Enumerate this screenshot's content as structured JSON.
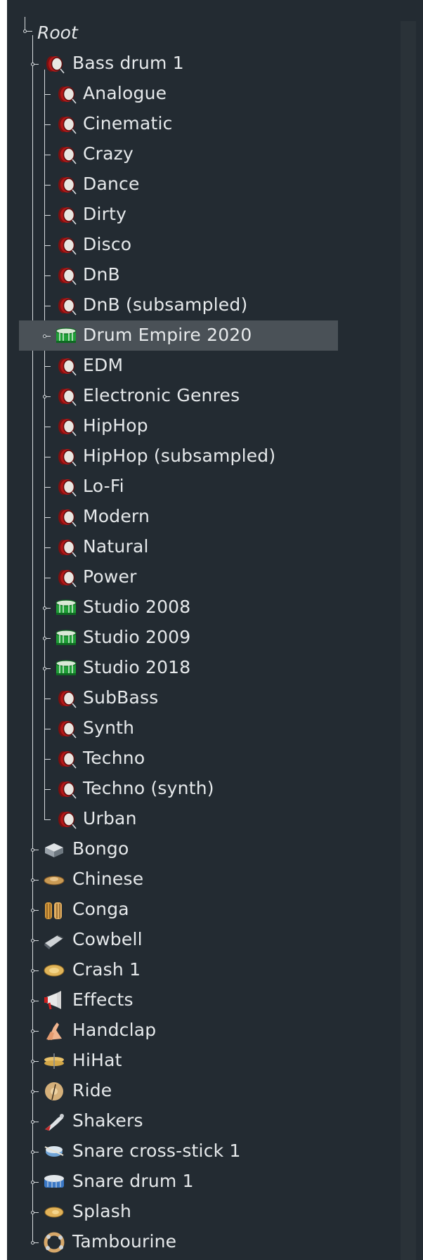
{
  "tree": {
    "root_label": "Root",
    "bass_drum": {
      "label": "Bass drum 1",
      "icon": "bass-drum-icon",
      "children": [
        {
          "label": "Analogue",
          "icon": "bass-drum-icon",
          "expandable": false
        },
        {
          "label": "Cinematic",
          "icon": "bass-drum-icon",
          "expandable": false
        },
        {
          "label": "Crazy",
          "icon": "bass-drum-icon",
          "expandable": false
        },
        {
          "label": "Dance",
          "icon": "bass-drum-icon",
          "expandable": false
        },
        {
          "label": "Dirty",
          "icon": "bass-drum-icon",
          "expandable": false
        },
        {
          "label": "Disco",
          "icon": "bass-drum-icon",
          "expandable": false
        },
        {
          "label": "DnB",
          "icon": "bass-drum-icon",
          "expandable": false
        },
        {
          "label": "DnB (subsampled)",
          "icon": "bass-drum-icon",
          "expandable": false
        },
        {
          "label": "Drum Empire 2020",
          "icon": "green-drum-icon",
          "expandable": true,
          "selected": true
        },
        {
          "label": "EDM",
          "icon": "bass-drum-icon",
          "expandable": false
        },
        {
          "label": "Electronic Genres",
          "icon": "bass-drum-icon",
          "expandable": true
        },
        {
          "label": "HipHop",
          "icon": "bass-drum-icon",
          "expandable": false
        },
        {
          "label": "HipHop (subsampled)",
          "icon": "bass-drum-icon",
          "expandable": false
        },
        {
          "label": "Lo-Fi",
          "icon": "bass-drum-icon",
          "expandable": false
        },
        {
          "label": "Modern",
          "icon": "bass-drum-icon",
          "expandable": false
        },
        {
          "label": "Natural",
          "icon": "bass-drum-icon",
          "expandable": false
        },
        {
          "label": "Power",
          "icon": "bass-drum-icon",
          "expandable": false
        },
        {
          "label": "Studio 2008",
          "icon": "green-drum-icon",
          "expandable": true
        },
        {
          "label": "Studio 2009",
          "icon": "green-drum-icon",
          "expandable": true
        },
        {
          "label": "Studio 2018",
          "icon": "green-drum-icon",
          "expandable": true
        },
        {
          "label": "SubBass",
          "icon": "bass-drum-icon",
          "expandable": false
        },
        {
          "label": "Synth",
          "icon": "bass-drum-icon",
          "expandable": false
        },
        {
          "label": "Techno",
          "icon": "bass-drum-icon",
          "expandable": false
        },
        {
          "label": "Techno (synth)",
          "icon": "bass-drum-icon",
          "expandable": false
        },
        {
          "label": "Urban",
          "icon": "bass-drum-icon",
          "expandable": false
        }
      ]
    },
    "categories": [
      {
        "label": "Bongo",
        "icon": "bongo-icon"
      },
      {
        "label": "Chinese",
        "icon": "chinese-cymbal-icon"
      },
      {
        "label": "Conga",
        "icon": "conga-icon"
      },
      {
        "label": "Cowbell",
        "icon": "cowbell-icon"
      },
      {
        "label": "Crash 1",
        "icon": "crash-cymbal-icon"
      },
      {
        "label": "Effects",
        "icon": "megaphone-icon"
      },
      {
        "label": "Handclap",
        "icon": "handclap-icon"
      },
      {
        "label": "HiHat",
        "icon": "hihat-icon"
      },
      {
        "label": "Ride",
        "icon": "ride-cymbal-icon"
      },
      {
        "label": "Shakers",
        "icon": "shaker-icon"
      },
      {
        "label": "Snare cross-stick 1",
        "icon": "snare-cross-stick-icon"
      },
      {
        "label": "Snare drum 1",
        "icon": "snare-drum-icon"
      },
      {
        "label": "Splash",
        "icon": "splash-cymbal-icon"
      },
      {
        "label": "Tambourine",
        "icon": "tambourine-icon"
      }
    ]
  }
}
